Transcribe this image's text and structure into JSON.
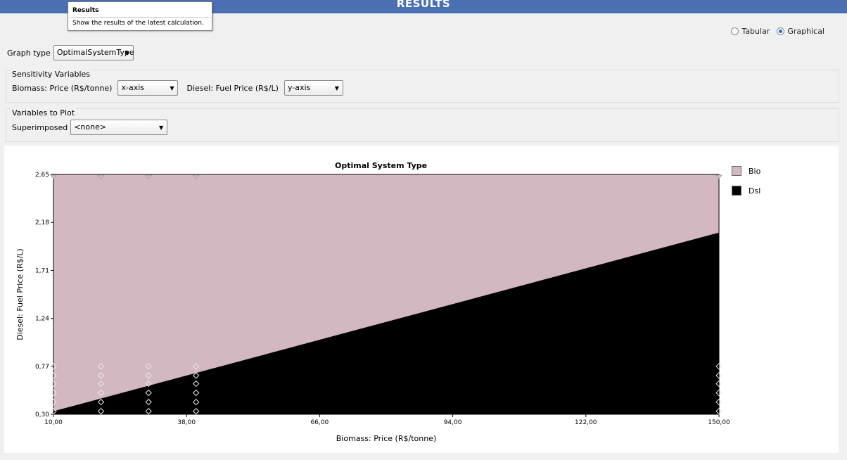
{
  "header": {
    "title": "RESULTS",
    "accent_color": "#4a70b2"
  },
  "tooltip": {
    "title": "Results",
    "text": "Show the results of the latest calculation."
  },
  "view_toggle": {
    "options": [
      {
        "label": "Tabular",
        "selected": false
      },
      {
        "label": "Graphical",
        "selected": true
      }
    ]
  },
  "graph_type": {
    "label": "Graph type",
    "value": "OptimalSystemType"
  },
  "sensitivity": {
    "legend": "Sensitivity Variables",
    "var1_label": "Biomass: Price (R$/tonne)",
    "var1_value": "x-axis",
    "var2_label": "Diesel: Fuel Price (R$/L)",
    "var2_value": "y-axis"
  },
  "plot_vars": {
    "legend": "Variables to Plot",
    "superimposed_label": "Superimposed",
    "superimposed_value": "<none>"
  },
  "icons": {
    "dropdown": "chevron-down-icon"
  },
  "chart_data": {
    "type": "area",
    "title": "Optimal System Type",
    "xlabel": "Biomass: Price (R$/tonne)",
    "ylabel": "Diesel: Fuel Price (R$/L)",
    "xlim": [
      10,
      150
    ],
    "ylim": [
      0.3,
      2.65
    ],
    "x_ticks": [
      "10,00",
      "38,00",
      "66,00",
      "94,00",
      "122,00",
      "150,00"
    ],
    "y_ticks": [
      "0,30",
      "0,77",
      "1,24",
      "1,71",
      "2,18",
      "2,65"
    ],
    "legend": [
      {
        "name": "Bio",
        "color": "#d4b8c1"
      },
      {
        "name": "Dsl",
        "color": "#000000"
      }
    ],
    "boundary": {
      "x": [
        10,
        150
      ],
      "y": [
        0.33,
        2.08
      ]
    },
    "markers_top_x": [
      10,
      20,
      30,
      40,
      150
    ],
    "marker_columns": [
      {
        "x": 10,
        "y": [
          0.33,
          0.42,
          0.51,
          0.6,
          0.68,
          0.77
        ]
      },
      {
        "x": 20,
        "y": [
          0.33,
          0.42,
          0.51,
          0.6,
          0.68,
          0.77
        ]
      },
      {
        "x": 30,
        "y": [
          0.33,
          0.42,
          0.51,
          0.6,
          0.68,
          0.77
        ]
      },
      {
        "x": 40,
        "y": [
          0.33,
          0.42,
          0.51,
          0.6,
          0.68,
          0.77
        ]
      },
      {
        "x": 150,
        "y": [
          0.33,
          0.42,
          0.51,
          0.6,
          0.68,
          0.77
        ]
      }
    ]
  }
}
